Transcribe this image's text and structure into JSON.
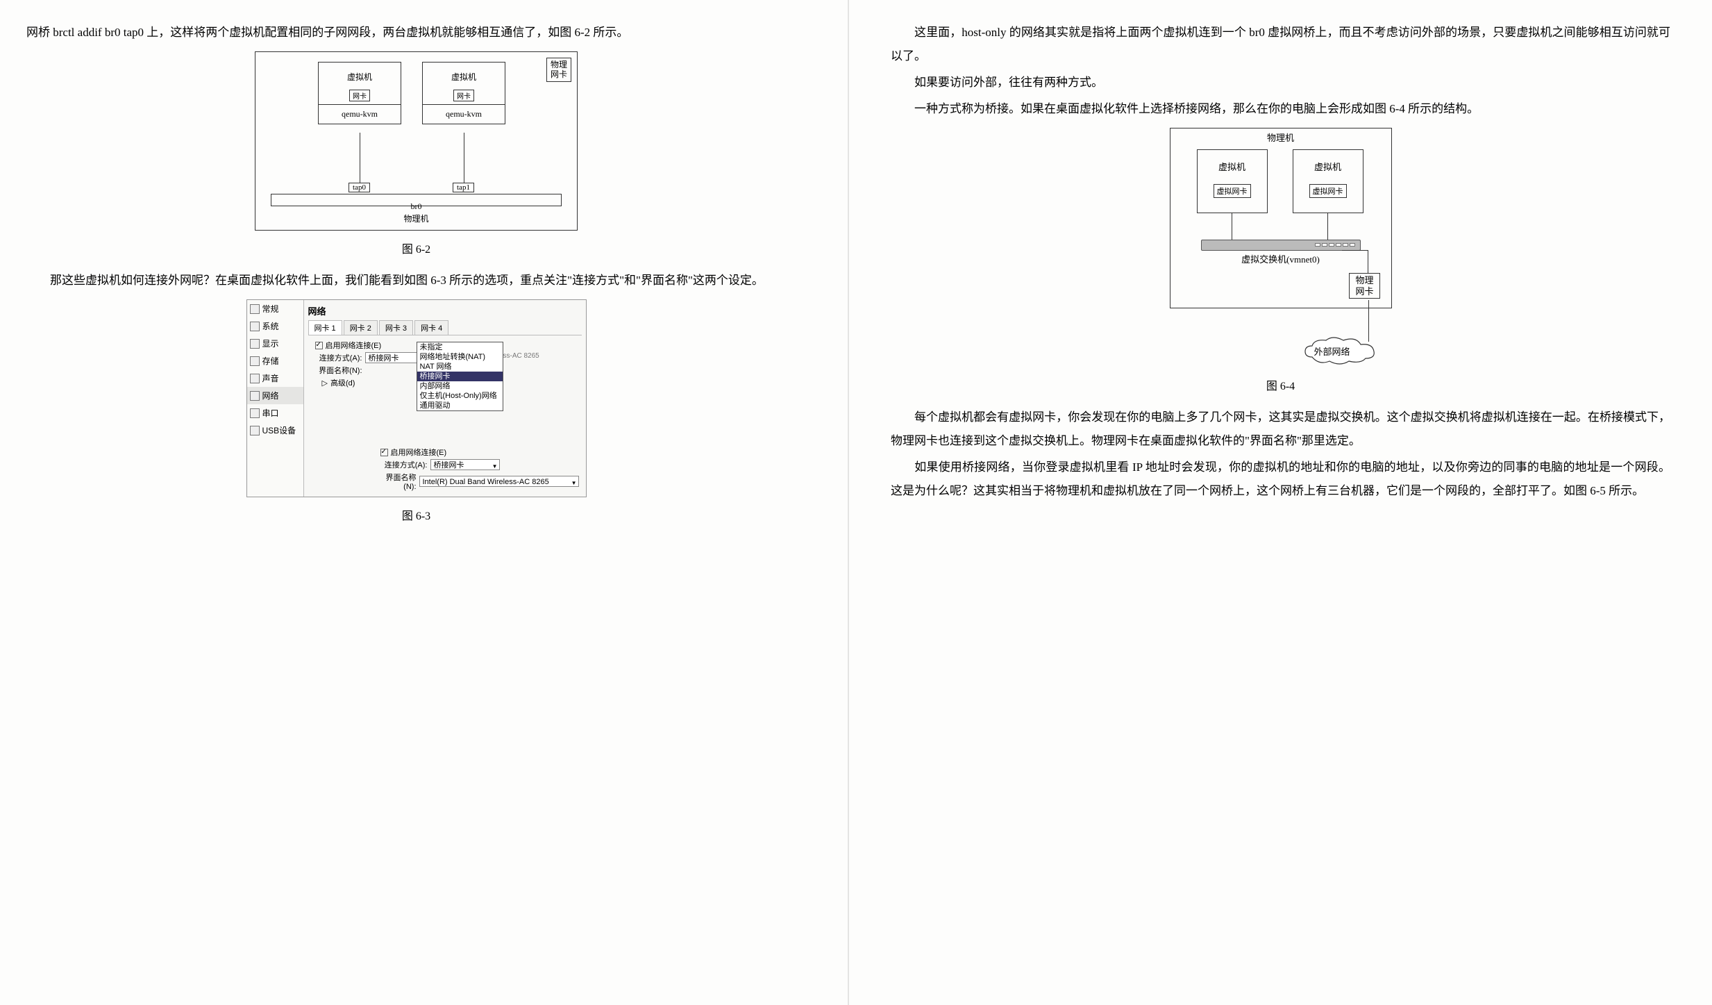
{
  "left": {
    "para1": "网桥 brctl addif br0 tap0 上，这样将两个虚拟机配置相同的子网网段，两台虚拟机就能够相互通信了，如图 6-2 所示。",
    "fig62": {
      "vm": "虚拟机",
      "nic": "网卡",
      "qemu": "qemu-kvm",
      "tap0": "tap0",
      "tap1": "tap1",
      "br0": "br0",
      "host": "物理机",
      "physnic1": "物理",
      "physnic2": "网卡",
      "caption": "图 6-2"
    },
    "para2": "那这些虚拟机如何连接外网呢？在桌面虚拟化软件上面，我们能看到如图 6-3 所示的选项，重点关注\"连接方式\"和\"界面名称\"这两个设定。",
    "fig63": {
      "sidebar": {
        "general": "常规",
        "system": "系统",
        "display": "显示",
        "storage": "存储",
        "audio": "声音",
        "network": "网络",
        "serial": "串口",
        "usb": "USB设备"
      },
      "title": "网络",
      "tabs": {
        "t1": "网卡 1",
        "t2": "网卡 2",
        "t3": "网卡 3",
        "t4": "网卡 4"
      },
      "enable_label": "启用网络连接(E)",
      "conn_label": "连接方式(A):",
      "iface_label": "界面名称(N):",
      "advanced_label": "高级(d)",
      "conn_value": "桥接网卡",
      "dropdown": {
        "opt1": "未指定",
        "opt2": "网络地址转换(NAT)",
        "opt3": "NAT 网络",
        "opt4": "桥接网卡",
        "opt5": "内部网络",
        "opt6": "仅主机(Host-Only)网络",
        "opt7": "通用驱动"
      },
      "iface_hint": "ss-AC 8265",
      "enable2_label": "启用网络连接(E)",
      "conn2_label": "连接方式(A):",
      "iface2_label": "界面名称(N):",
      "conn2_value": "桥接网卡",
      "iface2_value": "Intel(R) Dual Band Wireless-AC 8265",
      "caption": "图 6-3"
    }
  },
  "right": {
    "para1": "这里面，host-only 的网络其实就是指将上面两个虚拟机连到一个 br0 虚拟网桥上，而且不考虑访问外部的场景，只要虚拟机之间能够相互访问就可以了。",
    "para2": "如果要访问外部，往往有两种方式。",
    "para3": "一种方式称为桥接。如果在桌面虚拟化软件上选择桥接网络，那么在你的电脑上会形成如图 6-4 所示的结构。",
    "fig64": {
      "host_title": "物理机",
      "vm": "虚拟机",
      "vnic": "虚拟网卡",
      "switch": "虚拟交换机(vmnet0)",
      "pnic1": "物理",
      "pnic2": "网卡",
      "cloud": "外部网络",
      "caption": "图 6-4"
    },
    "para4": "每个虚拟机都会有虚拟网卡，你会发现在你的电脑上多了几个网卡，这其实是虚拟交换机。这个虚拟交换机将虚拟机连接在一起。在桥接模式下，物理网卡也连接到这个虚拟交换机上。物理网卡在桌面虚拟化软件的\"界面名称\"那里选定。",
    "para5": "如果使用桥接网络，当你登录虚拟机里看 IP 地址时会发现，你的虚拟机的地址和你的电脑的地址，以及你旁边的同事的电脑的地址是一个网段。这是为什么呢？这其实相当于将物理机和虚拟机放在了同一个网桥上，这个网桥上有三台机器，它们是一个网段的，全部打平了。如图 6-5 所示。"
  }
}
